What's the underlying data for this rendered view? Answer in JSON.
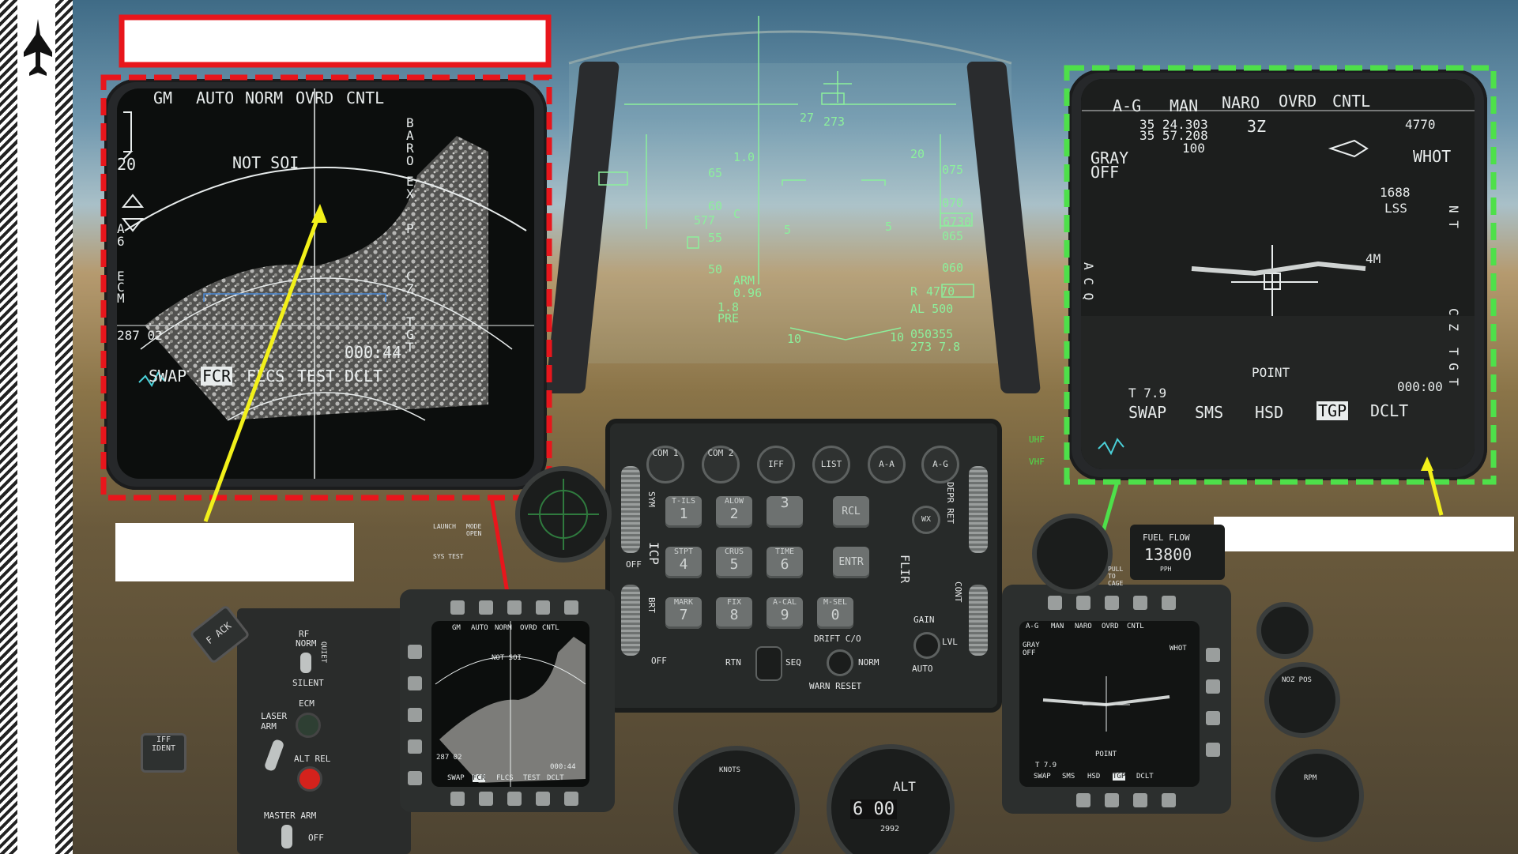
{
  "sidebar": {
    "jet_icon": "jet-silhouette-icon"
  },
  "title_box": {
    "text": ""
  },
  "left_callout": {
    "text": ""
  },
  "right_callout": {
    "text": ""
  },
  "colors": {
    "red_box": "#e8161c",
    "green_box": "#4ee04a",
    "yellow_arrow": "#f2f01a",
    "hud_green": "#8cf09c"
  },
  "left_mfd": {
    "top": [
      "GM",
      "AUTO",
      "NORM",
      "OVRD",
      "CNTL"
    ],
    "range": "20",
    "not_soi": "NOT SOI",
    "left_side": [
      "A",
      "6",
      "E",
      "C",
      "M"
    ],
    "right_side": [
      "B",
      "A",
      "R",
      "O",
      "E",
      "X",
      "P",
      "C",
      "Z",
      "T",
      "G",
      "T"
    ],
    "readout": "287 02",
    "timer": "000:44",
    "bottom": [
      "SWAP",
      "FCR",
      "FLCS",
      "TEST",
      "DCLT"
    ],
    "bottom_selected": "FCR"
  },
  "right_mfd": {
    "top": [
      "A-G",
      "MAN",
      "NARO",
      "OVRD",
      "CNTL"
    ],
    "coord1": "35 24.303",
    "coord2": "35 57.208",
    "coord3": "100",
    "field": "3Z",
    "elev": "4770",
    "gray": "GRAY",
    "off": "OFF",
    "whot": "WHOT",
    "lss_val": "1688",
    "lss": "LSS",
    "nt": "N T",
    "acq": "A C Q",
    "cz": "C Z",
    "tgt": "T G T",
    "mark": "4M",
    "point": "POINT",
    "t_val": "T 7.9",
    "timer": "000:00",
    "bottom": [
      "SWAP",
      "SMS",
      "HSD",
      "TGP",
      "DCLT"
    ],
    "bottom_selected": "TGP"
  },
  "hud": {
    "heading_27": "27",
    "heading_box": "273",
    "speed_box": "577",
    "alt_box": "6730",
    "ladder_left": [
      "1.0",
      "65",
      "60",
      "55",
      "50"
    ],
    "ladder_right": [
      "20",
      "075",
      "070",
      "065",
      "060"
    ],
    "c_mark": "C",
    "fpm_left": "5",
    "fpm_right": "5",
    "arm": "ARM",
    "g_val": "0.96",
    "g2": "1.8",
    "pre": "PRE",
    "r_box": "4770",
    "r_lbl": "R",
    "al": "AL  500",
    "time": "050355",
    "bearing": "273 7.8",
    "bank_10l": "10",
    "bank_10r": "10"
  },
  "icp": {
    "top_buttons": [
      "COM 1",
      "COM 2",
      "IFF",
      "LIST",
      "A-A",
      "A-G"
    ],
    "keys": [
      {
        "top": "T-ILS",
        "num": "1"
      },
      {
        "top": "ALOW",
        "num": "2"
      },
      {
        "top": "",
        "num": "3"
      },
      {
        "top": "STPT",
        "num": "4"
      },
      {
        "top": "CRUS",
        "num": "5"
      },
      {
        "top": "TIME",
        "num": "6"
      },
      {
        "top": "MARK",
        "num": "7"
      },
      {
        "top": "FIX",
        "num": "8"
      },
      {
        "top": "A-CAL",
        "num": "9"
      },
      {
        "top": "M-SEL",
        "num": "0"
      }
    ],
    "rcl": "RCL",
    "entr": "ENTR",
    "wx": "WX",
    "sym": "SYM",
    "icp": "ICP",
    "brt": "BRT",
    "off1": "OFF",
    "off2": "OFF",
    "flir": "FLIR",
    "rtn": "RTN",
    "seq": "SEQ",
    "drift": "DRIFT C/O",
    "norm": "NORM",
    "warn": "WARN RESET",
    "gain": "GAIN",
    "lvl": "LVL",
    "auto": "AUTO",
    "cont": "CONT",
    "dep_ret": "DEPR RET"
  },
  "misc": {
    "uhf": "UHF",
    "vhf": "VHF",
    "fuel_flow": "FUEL FLOW",
    "fuel_val": "13800",
    "pph": "PPH",
    "rf": "RF",
    "norm": "NORM",
    "quiet": "QUIET",
    "silent": "SILENT",
    "ecm": "ECM",
    "laser_arm": "LASER ARM",
    "alt_rel": "ALT REL",
    "master_arm": "MASTER ARM",
    "off": "OFF",
    "iff_ident": "IFF IDENT",
    "fack": "F ACK",
    "launch": "LAUNCH",
    "mode_open": "MODE OPEN",
    "sys_test": "SYS TEST",
    "knots": "KNOTS",
    "alt": "ALT",
    "alt_drum": "6 00",
    "alt_small": "2992",
    "noz_pos": "NOZ POS",
    "rpm": "RPM",
    "pull_cage": "PULL TO CAGE"
  }
}
